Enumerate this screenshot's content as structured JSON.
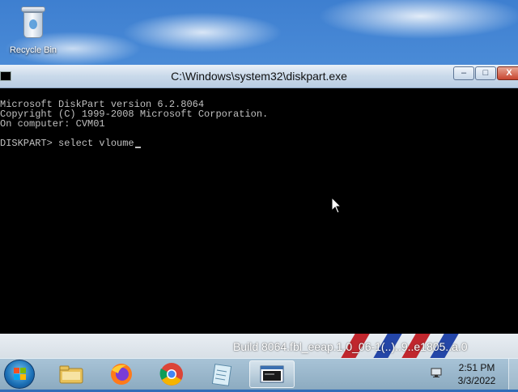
{
  "desktop": {
    "icons": [
      {
        "label": "Recycle Bin",
        "icon": "recycle-bin-icon"
      }
    ],
    "watermark": "Build 8064.fbl_eeap.1.0_06-1(..)..9..e1805..a.0"
  },
  "window": {
    "title": "C:\\Windows\\system32\\diskpart.exe",
    "buttons": {
      "minimize": "–",
      "maximize": "□",
      "close": "X"
    },
    "console_lines": [
      "Microsoft DiskPart version 6.2.8064",
      "Copyright (C) 1999-2008 Microsoft Corporation.",
      "On computer: CVM01",
      "",
      "DISKPART> select vloume"
    ]
  },
  "taskbar": {
    "pinned": [
      {
        "name": "file-explorer",
        "icon": "folder-icon"
      },
      {
        "name": "firefox",
        "icon": "firefox-icon"
      },
      {
        "name": "chrome",
        "icon": "chrome-icon"
      },
      {
        "name": "notepad",
        "icon": "notepad-icon"
      },
      {
        "name": "diskpart-console",
        "icon": "console-icon",
        "active": true
      }
    ],
    "clock": {
      "time": "2:51 PM",
      "date": "3/3/2022"
    }
  },
  "colors": {
    "console_bg": "#000000",
    "console_text": "#c0c0c0",
    "titlebar": "#c9d9ea",
    "close_button": "#c7452f"
  }
}
